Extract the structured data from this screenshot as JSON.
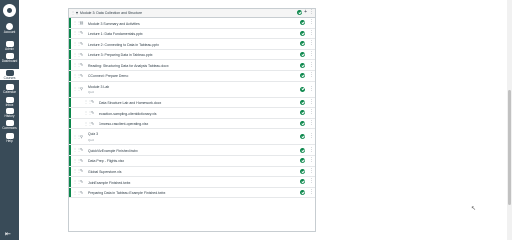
{
  "nav": {
    "items": [
      {
        "label": "Account",
        "icon": "user-icon"
      },
      {
        "label": "Admin",
        "icon": "shield-icon"
      },
      {
        "label": "Dashboard",
        "icon": "dashboard-icon"
      },
      {
        "label": "Courses",
        "icon": "book-icon",
        "active": true
      },
      {
        "label": "Calendar",
        "icon": "calendar-icon"
      },
      {
        "label": "Inbox",
        "icon": "inbox-icon"
      },
      {
        "label": "History",
        "icon": "clock-icon"
      },
      {
        "label": "Commons",
        "icon": "commons-icon"
      },
      {
        "label": "Help",
        "icon": "question-icon"
      }
    ],
    "collapse_glyph": "⇤"
  },
  "module": {
    "title": "Module 3: Data Collection and Structure",
    "status_color": "#0b874b",
    "items": [
      {
        "title": "Module 3 Summary and Activities",
        "icon": "page-icon",
        "indent": 0
      },
      {
        "title": "Lecture 1: Data Fundamentals.pptx",
        "icon": "attachment-icon",
        "indent": 0
      },
      {
        "title": "Lecture 2: Connecting to Data in Tableau.pptx",
        "icon": "attachment-icon",
        "indent": 0
      },
      {
        "title": "Lecture 3: Preparing Data in Tableau.pptx",
        "icon": "attachment-icon",
        "indent": 0
      },
      {
        "title": "Reading: Structuring Data for Analysis Tableau.docx",
        "icon": "attachment-icon",
        "indent": 0
      },
      {
        "title": "CConnect: Prepare Demo",
        "icon": "attachment-icon",
        "indent": 0
      },
      {
        "title": "Module 3 Lab",
        "subtitle": "Quiz",
        "icon": "quiz-icon",
        "indent": 0,
        "tall": true
      },
      {
        "title": "Data Structure Lab and Homework.docx",
        "icon": "attachment-icon",
        "indent": 1
      },
      {
        "title": "ecaction-sampling-clientdictionary.xls",
        "icon": "attachment-icon",
        "indent": 1
      },
      {
        "title": "1mceso-rasclient-operating.xlsx",
        "icon": "attachment-icon",
        "indent": 1
      },
      {
        "title": "Quiz 3",
        "subtitle": "Quiz",
        "icon": "quiz-icon",
        "indent": 0,
        "tall": true
      },
      {
        "title": "QuickVizExample Finished.twbx",
        "icon": "attachment-icon",
        "indent": 0
      },
      {
        "title": "Data Prep - Flights.xlsx",
        "icon": "attachment-icon",
        "indent": 0
      },
      {
        "title": "Global Superstore.xls",
        "icon": "attachment-icon",
        "indent": 0
      },
      {
        "title": "JoinExample Finished.twbx",
        "icon": "attachment-icon",
        "indent": 0
      },
      {
        "title": "Preparing Data in Tableau Example Finished.twbx",
        "icon": "attachment-icon",
        "indent": 0
      }
    ]
  }
}
